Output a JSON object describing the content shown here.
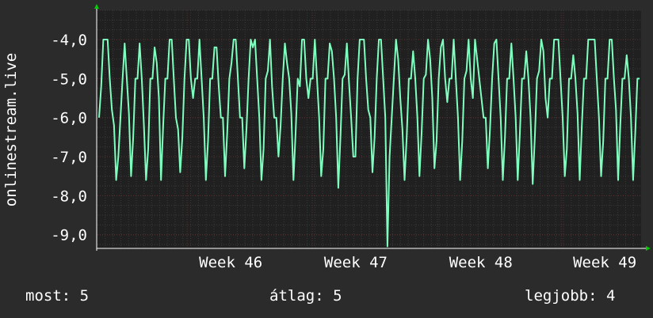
{
  "chart_data": {
    "type": "line",
    "ylabel": "onlinestream.live",
    "ylim": [
      -9.35,
      -3.25
    ],
    "yticks": [
      {
        "v": -4,
        "label": "-4,0"
      },
      {
        "v": -5,
        "label": "-5,0"
      },
      {
        "v": -6,
        "label": "-6,0"
      },
      {
        "v": -7,
        "label": "-7,0"
      },
      {
        "v": -8,
        "label": "-8,0"
      },
      {
        "v": -9,
        "label": "-9,0"
      }
    ],
    "xlim": [
      0,
      1
    ],
    "xticks": [
      {
        "v": 0.165,
        "label": "Week 46"
      },
      {
        "v": 0.395,
        "label": "Week 47"
      },
      {
        "v": 0.625,
        "label": "Week 48"
      },
      {
        "v": 0.853,
        "label": "Week 49"
      }
    ],
    "grid": true,
    "colors": {
      "background": "#2b2b2b",
      "plot_background": "#202020",
      "line": "#7fffbf",
      "grid_minor": "#3a3a3a",
      "grid_major": "#5a3030",
      "arrow": "#00cc00"
    },
    "series": [
      {
        "values": [
          -6.0,
          -5.2,
          -4.0,
          -4.0,
          -4.0,
          -5.0,
          -5.8,
          -6.2,
          -7.6,
          -7.0,
          -6.0,
          -5.0,
          -4.1,
          -5.0,
          -5.9,
          -7.5,
          -6.5,
          -5.0,
          -5.0,
          -4.1,
          -5.0,
          -6.2,
          -7.6,
          -6.8,
          -5.0,
          -5.0,
          -4.2,
          -4.6,
          -5.5,
          -7.6,
          -6.2,
          -5.0,
          -5.0,
          -4.0,
          -4.0,
          -5.0,
          -6.0,
          -6.3,
          -7.4,
          -6.5,
          -5.0,
          -4.0,
          -4.0,
          -5.0,
          -5.5,
          -5.0,
          -5.0,
          -4.0,
          -5.0,
          -6.0,
          -7.6,
          -6.6,
          -5.0,
          -5.0,
          -4.2,
          -4.2,
          -5.2,
          -6.0,
          -6.0,
          -7.5,
          -6.4,
          -5.0,
          -4.6,
          -4.0,
          -4.0,
          -5.0,
          -6.0,
          -6.0,
          -7.3,
          -6.3,
          -5.0,
          -4.0,
          -4.2,
          -4.0,
          -5.0,
          -6.0,
          -7.6,
          -6.8,
          -5.0,
          -4.8,
          -4.0,
          -5.2,
          -6.0,
          -6.0,
          -7.0,
          -6.2,
          -5.0,
          -4.1,
          -4.6,
          -5.0,
          -5.9,
          -7.6,
          -6.4,
          -5.0,
          -5.2,
          -4.0,
          -4.0,
          -5.0,
          -5.5,
          -5.0,
          -5.0,
          -4.0,
          -5.0,
          -6.0,
          -7.5,
          -6.8,
          -5.0,
          -5.0,
          -4.1,
          -4.3,
          -5.0,
          -6.0,
          -7.8,
          -6.5,
          -5.0,
          -4.9,
          -4.1,
          -5.1,
          -6.0,
          -7.0,
          -7.0,
          -5.0,
          -4.0,
          -4.0,
          -4.0,
          -5.0,
          -5.8,
          -6.0,
          -7.4,
          -6.5,
          -5.0,
          -4.0,
          -4.0,
          -5.0,
          -6.0,
          -9.3,
          -7.0,
          -6.0,
          -5.0,
          -4.0,
          -4.5,
          -5.5,
          -6.3,
          -7.6,
          -6.5,
          -5.0,
          -5.0,
          -4.3,
          -5.0,
          -6.0,
          -7.5,
          -6.4,
          -5.0,
          -4.9,
          -4.0,
          -4.5,
          -5.5,
          -7.3,
          -6.6,
          -5.0,
          -4.2,
          -4.0,
          -5.0,
          -5.6,
          -5.0,
          -5.0,
          -4.0,
          -5.0,
          -6.0,
          -7.6,
          -6.6,
          -5.0,
          -4.8,
          -4.0,
          -5.0,
          -5.5,
          -4.0,
          -4.5,
          -5.0,
          -5.5,
          -6.0,
          -6.0,
          -7.3,
          -6.3,
          -5.0,
          -4.1,
          -4.0,
          -5.0,
          -6.0,
          -7.6,
          -6.5,
          -5.0,
          -5.0,
          -4.1,
          -5.0,
          -6.0,
          -7.6,
          -6.4,
          -5.0,
          -5.0,
          -4.3,
          -5.0,
          -6.0,
          -7.7,
          -6.5,
          -5.0,
          -4.8,
          -4.0,
          -4.3,
          -5.5,
          -6.0,
          -5.0,
          -5.0,
          -4.0,
          -4.0,
          -4.0,
          -5.0,
          -6.0,
          -7.5,
          -6.8,
          -5.0,
          -5.0,
          -4.4,
          -5.0,
          -5.9,
          -7.6,
          -6.2,
          -5.0,
          -5.0,
          -4.0,
          -4.0,
          -4.0,
          -4.0,
          -5.0,
          -6.0,
          -7.5,
          -6.6,
          -5.0,
          -5.0,
          -4.0,
          -4.0,
          -5.0,
          -5.8,
          -7.6,
          -6.2,
          -5.0,
          -5.0,
          -4.4,
          -5.0,
          -6.0,
          -7.6,
          -6.4,
          -5.0,
          -5.0
        ]
      }
    ]
  },
  "stats": {
    "now": "most: 5",
    "avg": "átlag: 5",
    "best": "legjobb: 4"
  }
}
